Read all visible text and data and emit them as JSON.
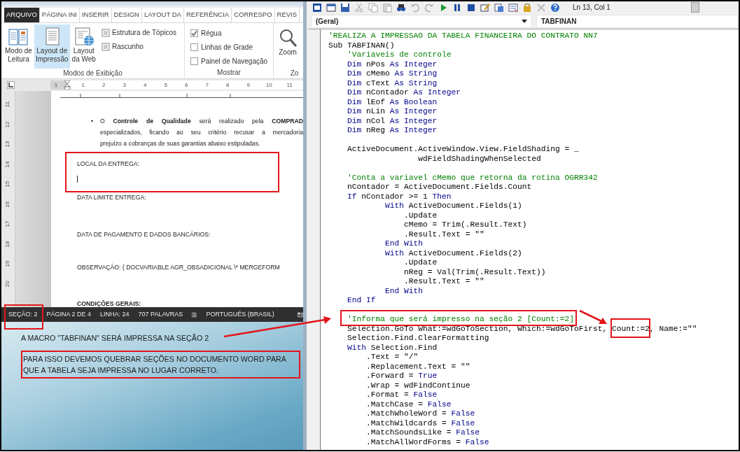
{
  "word": {
    "tabs": [
      {
        "label": "ARQUIVO",
        "kind": "file"
      },
      {
        "label": "PÁGINA INI",
        "kind": "tab"
      },
      {
        "label": "INSERIR",
        "kind": "tab"
      },
      {
        "label": "DESIGN",
        "kind": "tab"
      },
      {
        "label": "LAYOUT DA",
        "kind": "tab"
      },
      {
        "label": "REFERÊNCIA",
        "kind": "tab"
      },
      {
        "label": "CORRESPO",
        "kind": "tab"
      },
      {
        "label": "REVIS",
        "kind": "tab"
      }
    ],
    "ribbon_groups": [
      {
        "label": "Modos de Exibição",
        "large_buttons": [
          {
            "lines": [
              "Modo de",
              "Leitura"
            ],
            "kind": "book",
            "selected": false
          },
          {
            "lines": [
              "Layout de",
              "Impressão"
            ],
            "kind": "page",
            "selected": true
          },
          {
            "lines": [
              "Layout",
              "da Web"
            ],
            "kind": "web",
            "selected": false
          }
        ],
        "small_buttons": [
          {
            "label": "Estrutura de Tópicos"
          },
          {
            "label": "Rascunho"
          }
        ]
      },
      {
        "label": "Mostrar",
        "checkboxes": [
          {
            "label": "Régua",
            "checked": true
          },
          {
            "label": "Linhas de Grade",
            "checked": false
          },
          {
            "label": "Painel de Navegação",
            "checked": false
          }
        ]
      },
      {
        "label": "Zo",
        "large_buttons": [
          {
            "lines": [
              "Zoom"
            ],
            "kind": "zoom",
            "selected": false
          }
        ]
      }
    ],
    "ruler_numbers": [
      "1",
      "1",
      "2",
      "3",
      "4",
      "5",
      "6",
      "7",
      "8",
      "9",
      "10",
      "11"
    ],
    "vertical_ruler_numbers": [
      "11",
      "12",
      "13",
      "14",
      "15",
      "16",
      "17",
      "18",
      "19",
      "20"
    ],
    "paragraphs": [
      {
        "kind": "bullet",
        "bullet": "•",
        "lines": [
          "O **Controle de Qualidade** será realizado pela **COMPRAD**",
          "especializados, ficando ao seu critério recusar a mercadoria",
          "prejuízo a cobranças de suas garantias abaixo estipuladas."
        ]
      },
      {
        "kind": "plain",
        "text": "LOCAL DA ENTREGA:",
        "highlighted": true,
        "cursor": true
      },
      {
        "kind": "plain",
        "text": "DATA LIMITE ENTREGA:",
        "highlighted": false
      },
      {
        "kind": "plain",
        "text": "DATA DE PAGAMENTO E DADOS BANCÁRIOS:",
        "highlighted": false
      },
      {
        "kind": "plain",
        "text": "OBSERVAÇÃO: { DOCVARIABLE  AGR_OBSADICIONAL  \\* MERGEFORM",
        "highlighted": false
      },
      {
        "kind": "heading",
        "text": "CONDIÇÕES GERAIS:",
        "highlighted": false
      }
    ],
    "status_bar": [
      {
        "kind": "text",
        "text": "SEÇÃO: 2",
        "highlighted": true
      },
      {
        "kind": "text",
        "text": "PÁGINA 2 DE 4",
        "highlighted": false
      },
      {
        "kind": "text",
        "text": "LINHA: 24",
        "highlighted": false
      },
      {
        "kind": "text",
        "text": "707 PALAVRAS",
        "highlighted": false
      },
      {
        "kind": "icon"
      },
      {
        "kind": "text",
        "text": "PORTUGUÊS (BRASIL)",
        "highlighted": false
      },
      {
        "kind": "icon"
      }
    ]
  },
  "desktop_notes": [
    {
      "text": "A MACRO \"TABFINAN\" SERÁ IMPRESSA NA SEÇÃO 2",
      "highlighted": false
    },
    {
      "text": "PARA ISSO DEVEMOS QUEBRAR SEÇÕES NO DOCUMENTO WORD PARA QUE A TABELA SEJA IMPRESSA NO LUGAR CORRETO.",
      "highlighted": true
    }
  ],
  "vba": {
    "position": "Ln 13, Col 1",
    "object_combo": "(Geral)",
    "procedure_combo": "TABFINAN",
    "code_lines": [
      {
        "segments": [
          {
            "text": "'REALIZA A IMPRESSAO DA TABELA FINANCEIRA DO CONTRATO NN7",
            "kind": "comment"
          }
        ]
      },
      {
        "segments": [
          {
            "text": "Sub TABFINAN()",
            "kind": "code"
          }
        ]
      },
      {
        "segments": [
          {
            "text": "    'Variaveis de controle",
            "kind": "comment"
          }
        ]
      },
      {
        "segments": [
          {
            "text": "    Dim",
            "kind": "keyword"
          },
          {
            "text": " nPos ",
            "kind": "code"
          },
          {
            "text": "As Integer",
            "kind": "keyword"
          }
        ]
      },
      {
        "segments": [
          {
            "text": "    Dim",
            "kind": "keyword"
          },
          {
            "text": " cMemo ",
            "kind": "code"
          },
          {
            "text": "As String",
            "kind": "keyword"
          }
        ]
      },
      {
        "segments": [
          {
            "text": "    Dim",
            "kind": "keyword"
          },
          {
            "text": " cText ",
            "kind": "code"
          },
          {
            "text": "As String",
            "kind": "keyword"
          }
        ]
      },
      {
        "segments": [
          {
            "text": "    Dim",
            "kind": "keyword"
          },
          {
            "text": " nContador ",
            "kind": "code"
          },
          {
            "text": "As Integer",
            "kind": "keyword"
          }
        ]
      },
      {
        "segments": [
          {
            "text": "    Dim",
            "kind": "keyword"
          },
          {
            "text": " lEof ",
            "kind": "code"
          },
          {
            "text": "As Boolean",
            "kind": "keyword"
          }
        ]
      },
      {
        "segments": [
          {
            "text": "    Dim",
            "kind": "keyword"
          },
          {
            "text": " nLin ",
            "kind": "code"
          },
          {
            "text": "As Integer",
            "kind": "keyword"
          }
        ]
      },
      {
        "segments": [
          {
            "text": "    Dim",
            "kind": "keyword"
          },
          {
            "text": " nCol ",
            "kind": "code"
          },
          {
            "text": "As Integer",
            "kind": "keyword"
          }
        ]
      },
      {
        "segments": [
          {
            "text": "    Dim",
            "kind": "keyword"
          },
          {
            "text": " nReg ",
            "kind": "code"
          },
          {
            "text": "As Integer",
            "kind": "keyword"
          }
        ]
      },
      {
        "kind": "blank"
      },
      {
        "segments": [
          {
            "text": "    ActiveDocument.ActiveWindow.View.FieldShading = _",
            "kind": "code"
          }
        ]
      },
      {
        "segments": [
          {
            "text": "                   wdFieldShadingWhenSelected",
            "kind": "code"
          }
        ]
      },
      {
        "kind": "blank"
      },
      {
        "segments": [
          {
            "text": "    'Conta a variavel cMemo que retorna da rotina OGRR342",
            "kind": "comment"
          }
        ]
      },
      {
        "segments": [
          {
            "text": "    nContador = ActiveDocument.Fields.Count",
            "kind": "code"
          }
        ]
      },
      {
        "segments": [
          {
            "text": "    If",
            "kind": "keyword"
          },
          {
            "text": " nContador >= 1 ",
            "kind": "code"
          },
          {
            "text": "Then",
            "kind": "keyword"
          }
        ]
      },
      {
        "segments": [
          {
            "text": "            With",
            "kind": "keyword"
          },
          {
            "text": " ActiveDocument.Fields(1)",
            "kind": "code"
          }
        ]
      },
      {
        "segments": [
          {
            "text": "                .Update",
            "kind": "code"
          }
        ]
      },
      {
        "segments": [
          {
            "text": "                cMemo = Trim(.Result.Text)",
            "kind": "code"
          }
        ]
      },
      {
        "segments": [
          {
            "text": "                .Result.Text = \"\"",
            "kind": "code"
          }
        ]
      },
      {
        "segments": [
          {
            "text": "            End With",
            "kind": "keyword"
          }
        ]
      },
      {
        "segments": [
          {
            "text": "            With",
            "kind": "keyword"
          },
          {
            "text": " ActiveDocument.Fields(2)",
            "kind": "code"
          }
        ]
      },
      {
        "segments": [
          {
            "text": "                .Update",
            "kind": "code"
          }
        ]
      },
      {
        "segments": [
          {
            "text": "                nReg = Val(Trim(.Result.Text))",
            "kind": "code"
          }
        ]
      },
      {
        "segments": [
          {
            "text": "                .Result.Text = \"\"",
            "kind": "code"
          }
        ]
      },
      {
        "segments": [
          {
            "text": "            End With",
            "kind": "keyword"
          }
        ]
      },
      {
        "segments": [
          {
            "text": "    End If",
            "kind": "keyword"
          }
        ]
      },
      {
        "kind": "blank"
      },
      {
        "segments": [
          {
            "text": "    'Informa que será impresso na seção 2 [Count:=2]",
            "kind": "comment",
            "highlighted": true
          }
        ]
      },
      {
        "segments": [
          {
            "text": "    Selection.GoTo What:=wdGoToSection, Which:=wdGoToFirst, ",
            "kind": "code"
          },
          {
            "text": "Count:=2",
            "kind": "code",
            "highlighted": true
          },
          {
            "text": ", Name:=\"\"",
            "kind": "code"
          }
        ]
      },
      {
        "segments": [
          {
            "text": "    Selection.Find.ClearFormatting",
            "kind": "code"
          }
        ]
      },
      {
        "segments": [
          {
            "text": "    With",
            "kind": "keyword"
          },
          {
            "text": " Selection.Find",
            "kind": "code"
          }
        ]
      },
      {
        "segments": [
          {
            "text": "        .Text = \"/\"",
            "kind": "code"
          }
        ]
      },
      {
        "segments": [
          {
            "text": "        .Replacement.Text = \"\"",
            "kind": "code"
          }
        ]
      },
      {
        "segments": [
          {
            "text": "        .Forward = ",
            "kind": "code"
          },
          {
            "text": "True",
            "kind": "keyword"
          }
        ]
      },
      {
        "segments": [
          {
            "text": "        .Wrap = wdFindContinue",
            "kind": "code"
          }
        ]
      },
      {
        "segments": [
          {
            "text": "        .Format = ",
            "kind": "code"
          },
          {
            "text": "False",
            "kind": "keyword"
          }
        ]
      },
      {
        "segments": [
          {
            "text": "        .MatchCase = ",
            "kind": "code"
          },
          {
            "text": "False",
            "kind": "keyword"
          }
        ]
      },
      {
        "segments": [
          {
            "text": "        .MatchWholeWord = ",
            "kind": "code"
          },
          {
            "text": "False",
            "kind": "keyword"
          }
        ]
      },
      {
        "segments": [
          {
            "text": "        .MatchWildcards = ",
            "kind": "code"
          },
          {
            "text": "False",
            "kind": "keyword"
          }
        ]
      },
      {
        "segments": [
          {
            "text": "        .MatchSoundsLike = ",
            "kind": "code"
          },
          {
            "text": "False",
            "kind": "keyword"
          }
        ]
      },
      {
        "segments": [
          {
            "text": "        .MatchAllWordForms = ",
            "kind": "code"
          },
          {
            "text": "False",
            "kind": "keyword"
          }
        ]
      }
    ]
  }
}
